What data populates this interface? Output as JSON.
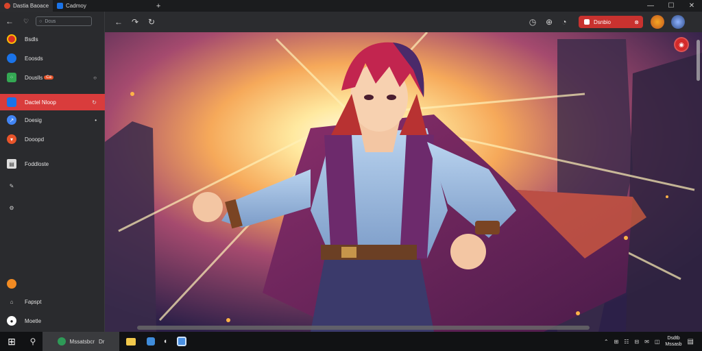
{
  "window": {
    "tabs": [
      {
        "label": "Dastia Baoace",
        "icon": "shield-tab-icon",
        "active": true
      },
      {
        "label": "Cadmoy",
        "icon": "blue-app-tab-icon",
        "active": false
      }
    ],
    "new_tab": "+",
    "controls": {
      "minimize": "—",
      "maximize": "☐",
      "close": "✕"
    }
  },
  "sidebar": {
    "search_placeholder": "Dcus",
    "items": [
      {
        "label": "Bsdls",
        "icon": "red-circle-icon",
        "badge": "",
        "color": "#d93025"
      },
      {
        "label": "Eoosds",
        "icon": "blue-circle-icon",
        "badge": "",
        "color": "#1a73e8"
      },
      {
        "label": "Douslls",
        "icon": "grid-icon",
        "badge": "Ca",
        "color": "#34a853"
      },
      {
        "label": "Dactel Nloop",
        "icon": "app-square-icon",
        "badge": "",
        "color": "#1a73e8",
        "selected": true
      },
      {
        "label": "Doesig",
        "icon": "blue-swirl-icon",
        "badge": "",
        "color": "#4285f4"
      },
      {
        "label": "Dooopd",
        "icon": "red-shield-icon",
        "badge": "",
        "color": "#e8542a"
      },
      {
        "label": "Foddloste",
        "icon": "film-icon",
        "badge": "",
        "color": "#cccccc"
      },
      {
        "label": "",
        "icon": "pin-icon",
        "badge": "",
        "color": "#9aa0a6"
      },
      {
        "label": "",
        "icon": "settings-icon",
        "badge": "",
        "color": "#9aa0a6"
      },
      {
        "label": "",
        "icon": "orange-dot-icon",
        "badge": "",
        "color": "#f28b22"
      },
      {
        "label": "Fapspt",
        "icon": "basket-icon",
        "badge": "",
        "color": "#cccccc"
      },
      {
        "label": "Moetle",
        "icon": "profile-circle-icon",
        "badge": "",
        "color": "#ffffff"
      }
    ]
  },
  "toolbar": {
    "back": "←",
    "reload": "↻",
    "action_label": "Dsnbio",
    "accent": "#c8322f"
  },
  "taskbar": {
    "start": "⊞",
    "search": "⚲",
    "active_app": "Mssatsbcr",
    "active_app_suffix": "Dr",
    "clock_time": "Dsdtb",
    "clock_date": "Mssasb"
  }
}
